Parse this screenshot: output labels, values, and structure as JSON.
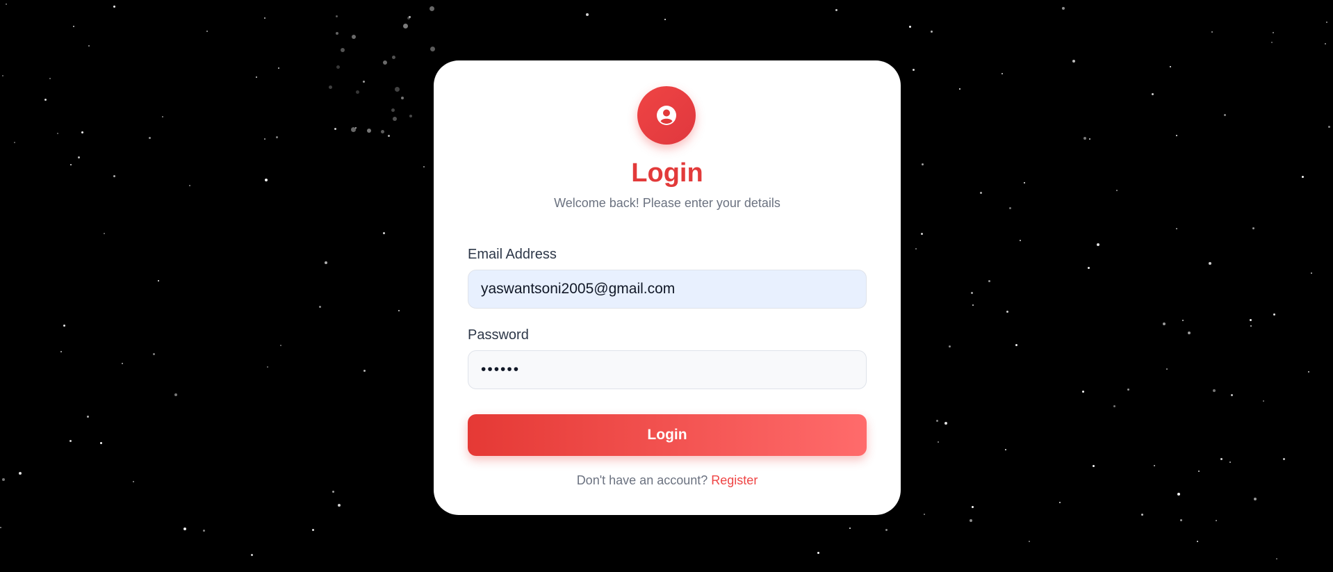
{
  "login_card": {
    "title": "Login",
    "subtitle": "Welcome back! Please enter your details",
    "email": {
      "label": "Email Address",
      "value": "yaswantsoni2005@gmail.com"
    },
    "password": {
      "label": "Password",
      "masked_value": "••••••"
    },
    "submit_label": "Login",
    "footer": {
      "prompt": "Don't have an account?",
      "link_label": "Register"
    },
    "avatar_icon": "user-circle-icon"
  },
  "colors": {
    "background": "#000000",
    "card": "#ffffff",
    "accent": "#ef4444",
    "accent_light": "#ff6b6b",
    "email_field_bg": "#e8f0fe",
    "password_field_bg": "#f8f9fb",
    "muted_text": "#6b7280",
    "label_text": "#2d3748"
  }
}
